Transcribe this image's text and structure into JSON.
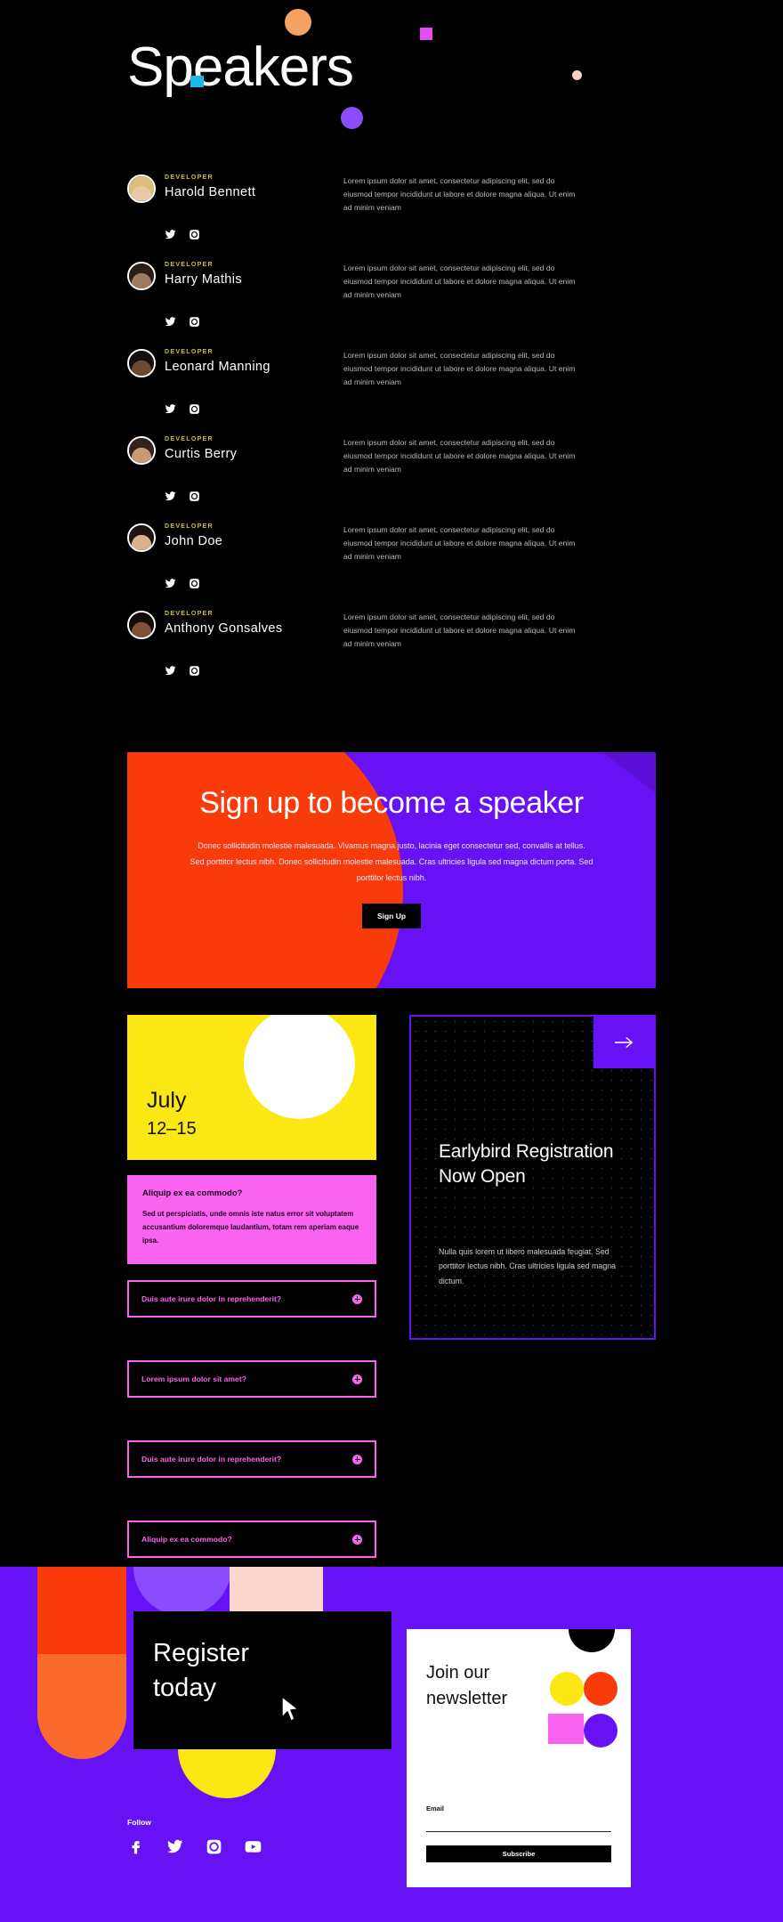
{
  "hero": {
    "title": "Speakers"
  },
  "speakers": {
    "bio": "Lorem ipsum dolor sit amet, consectetur adipiscing elit, sed do eiusmod tempor incididunt ut labore et dolore magna aliqua. Ut enim ad minim veniam",
    "items": [
      {
        "role": "DEVELOPER",
        "name": "Harold Bennett",
        "avatar_tone": "#e8c8a8",
        "hair": "#d8c07a"
      },
      {
        "role": "DEVELOPER",
        "name": "Harry Mathis",
        "avatar_tone": "#9a7a60",
        "hair": "#2a1f18"
      },
      {
        "role": "DEVELOPER",
        "name": "Leonard Manning",
        "avatar_tone": "#6b4a34",
        "hair": "#140f0c"
      },
      {
        "role": "DEVELOPER",
        "name": "Curtis Berry",
        "avatar_tone": "#c79b76",
        "hair": "#33231a"
      },
      {
        "role": "DEVELOPER",
        "name": "John Doe",
        "avatar_tone": "#d8b38e",
        "hair": "#1d1410"
      },
      {
        "role": "DEVELOPER",
        "name": "Anthony Gonsalves",
        "avatar_tone": "#7d5238",
        "hair": "#120c09"
      }
    ],
    "social_twitter": "twitter-icon",
    "social_instagram": "instagram-icon"
  },
  "cta": {
    "title": "Sign up to become a speaker",
    "body": "Donec sollicitudin molestie malesuada. Vivamus magna justo, lacinia eget consectetur sed, convallis at tellus. Sed porttitor lectus nibh. Donec sollicitudin molestie malesuada. Cras ultricies ligula sed magna dictum porta. Sed porttitor lectus nibh.",
    "button": "Sign Up"
  },
  "date_card": {
    "month": "July",
    "days": "12–15"
  },
  "pink_card": {
    "heading": "Aliquip ex ea commodo?",
    "body": "Sed ut perspiciatis, unde omnis iste natus error sit voluptatem accusantium doloremque laudantium, totam rem aperiam eaque ipsa."
  },
  "accordions": [
    {
      "label": "Duis aute irure dolor in reprehenderit?"
    },
    {
      "label": "Lorem ipsum dolor sit amet?"
    },
    {
      "label": "Duis aute irure dolor in reprehenderit?"
    },
    {
      "label": "Aliquip ex ea commodo?"
    }
  ],
  "earlybird": {
    "title": "Earlybird Registration Now Open",
    "body": "Nulla quis lorem ut libero malesuada feugiat. Sed porttitor lectus nibh. Cras ultricies ligula sed magna dictum.",
    "arrow": "arrow-right-icon"
  },
  "footer": {
    "register_line1": "Register",
    "register_line2": "today",
    "follow_label": "Follow",
    "socials": [
      "facebook-icon",
      "twitter-icon",
      "instagram-icon",
      "youtube-icon"
    ],
    "newsletter": {
      "title_line1": "Join our",
      "title_line2": "newsletter",
      "field_label": "Email",
      "field_value": "",
      "field_placeholder": "",
      "button": "Subscribe"
    }
  },
  "colors": {
    "bg": "#000000",
    "purple": "#6712f5",
    "orange": "#f93b0c",
    "yellow": "#fae714",
    "pink": "#f963ef",
    "peach": "#fad6cd",
    "role_yellow": "#c9c13a"
  }
}
